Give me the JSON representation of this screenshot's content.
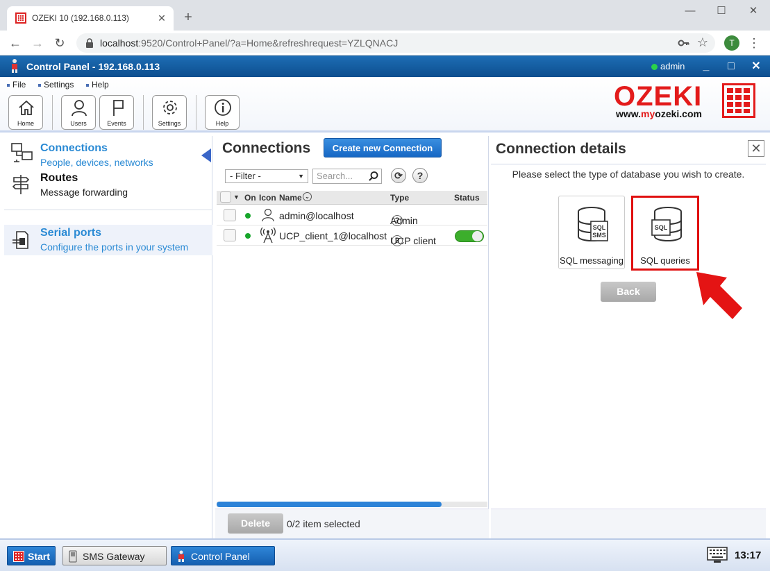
{
  "browser": {
    "tab_title": "OZEKI 10 (192.168.0.113)",
    "url_host": "localhost",
    "url_rest": ":9520/Control+Panel/?a=Home&refreshrequest=YZLQNACJ",
    "profile_initial": "T"
  },
  "app": {
    "title": "Control Panel - 192.168.0.113",
    "user": "admin",
    "status_color": "#2ad24a"
  },
  "menu": {
    "file": "File",
    "settings": "Settings",
    "help": "Help"
  },
  "toolbar": {
    "home": "Home",
    "users": "Users",
    "events": "Events",
    "settings": "Settings",
    "help": "Help"
  },
  "logo": {
    "word": "OZEKI",
    "url_prefix": "www.",
    "url_brand": "my",
    "url_suffix": "ozeki.com"
  },
  "nav": {
    "connections_title": "Connections",
    "connections_sub": "People, devices, networks",
    "routes_title": "Routes",
    "routes_sub": "Message forwarding",
    "serial_title": "Serial ports",
    "serial_sub": "Configure the ports in your system"
  },
  "connections": {
    "title": "Connections",
    "create_button": "Create new Connection",
    "filter_value": "- Filter -",
    "search_placeholder": "Search...",
    "columns": {
      "on": "On",
      "icon": "Icon",
      "name": "Name",
      "type": "Type",
      "status": "Status"
    },
    "rows": [
      {
        "name": "admin@localhost",
        "type": "Admin",
        "icon": "user-icon",
        "enabled": true
      },
      {
        "name": "UCP_client_1@localhost",
        "type": "UCP client",
        "icon": "antenna-icon",
        "enabled": true,
        "toggle_on": true
      }
    ],
    "delete_button": "Delete",
    "selected_count": "0/2 item selected",
    "scroll_progress_pct": 83
  },
  "details": {
    "title": "Connection details",
    "prompt": "Please select the type of database you wish to create.",
    "options": [
      {
        "label": "SQL messaging",
        "icon_text_1": "SQL",
        "icon_text_2": "SMS"
      },
      {
        "label": "SQL queries",
        "icon_text_1": "SQL"
      }
    ],
    "back_button": "Back"
  },
  "taskbar": {
    "start": "Start",
    "sms_gateway": "SMS Gateway",
    "control_panel": "Control Panel",
    "clock": "13:17"
  }
}
